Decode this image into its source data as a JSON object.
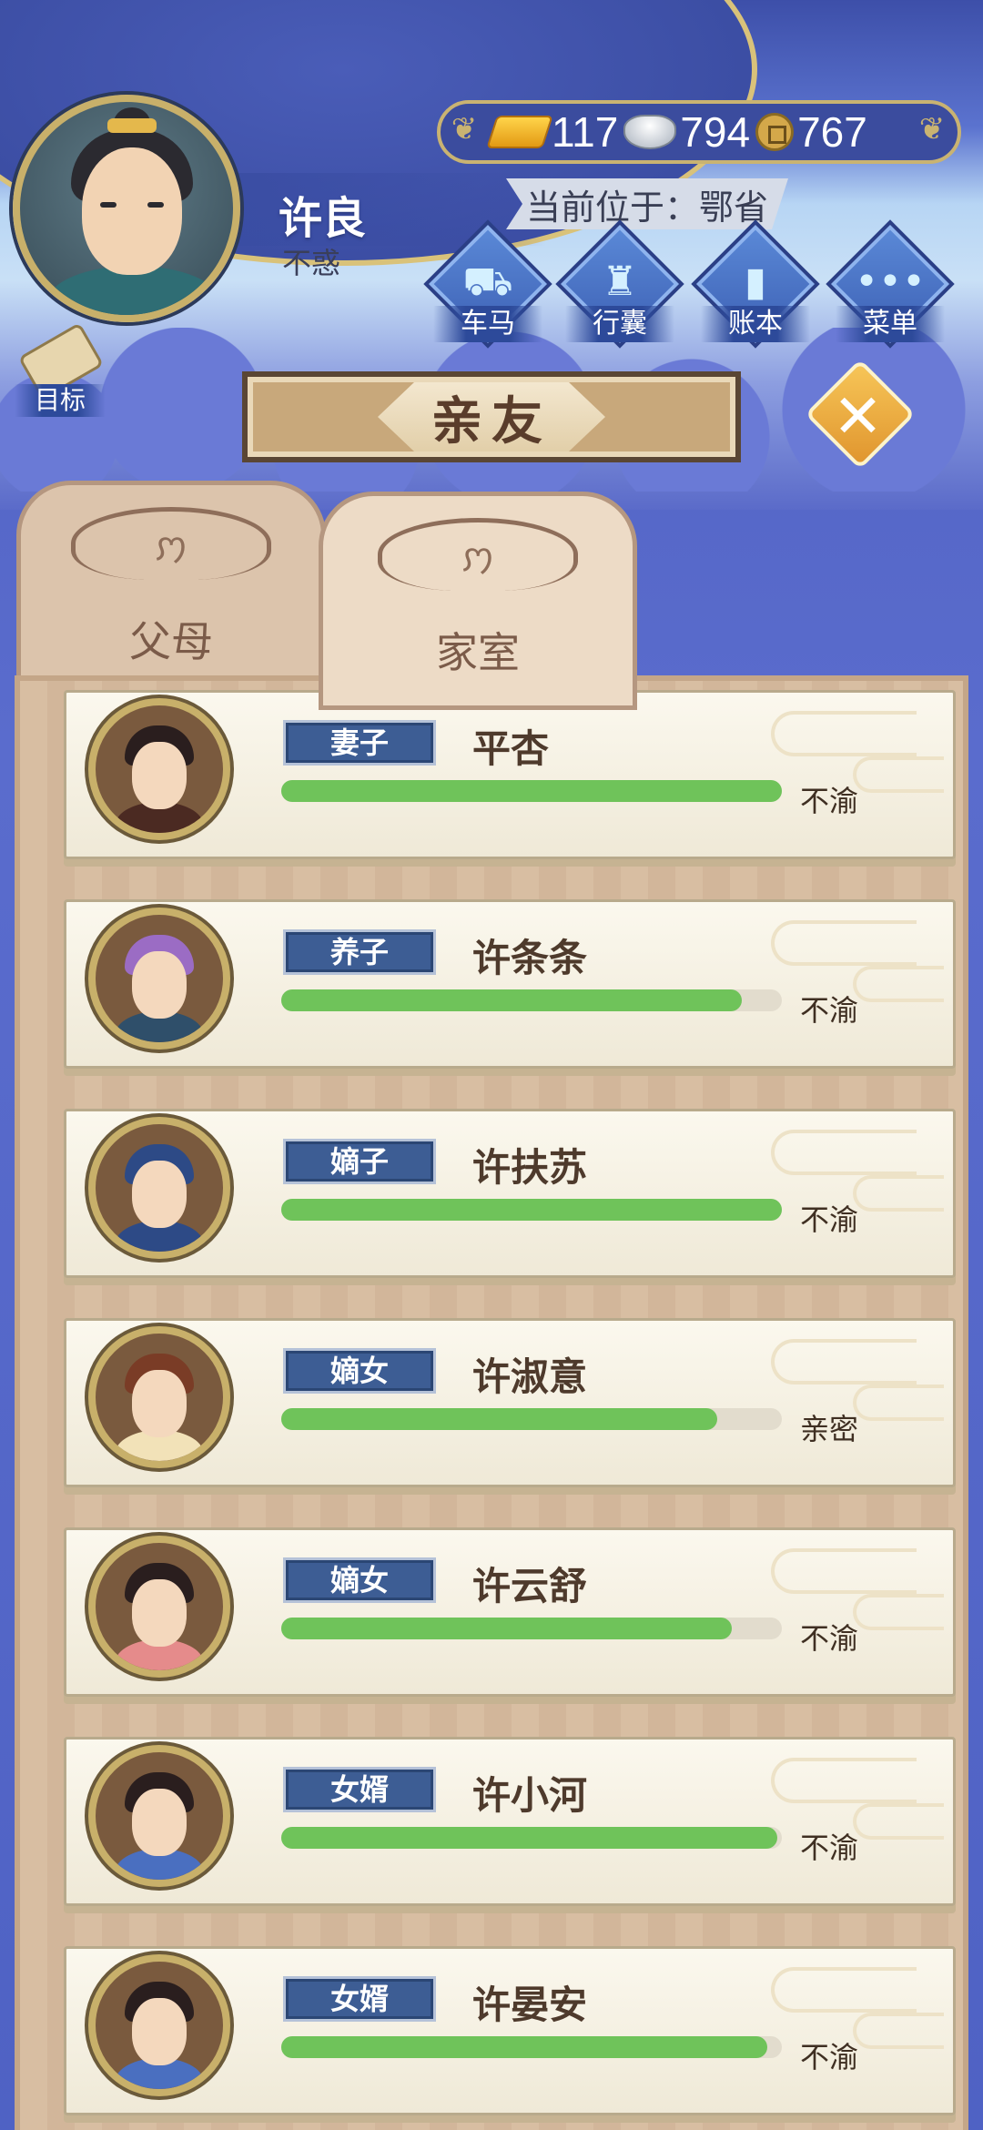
{
  "player": {
    "name": "许良",
    "title": "不惑"
  },
  "currency": {
    "gold": "117",
    "silver": "794",
    "coin": "767"
  },
  "location": "当前位于：鄂省",
  "menu": [
    {
      "label": "车马",
      "icon": "carriage-icon"
    },
    {
      "label": "行囊",
      "icon": "bag-icon"
    },
    {
      "label": "账本",
      "icon": "ledger-icon"
    },
    {
      "label": "菜单",
      "icon": "more-icon"
    }
  ],
  "goal_label": "目标",
  "banner_title": "亲友",
  "tabs": {
    "parents": "父母",
    "family": "家室"
  },
  "family": [
    {
      "relation": "妻子",
      "name": "平杏",
      "mood": "不渝",
      "affinity": 1.0,
      "robe": "#4b2a22",
      "hair": "#2a1e1e"
    },
    {
      "relation": "养子",
      "name": "许条条",
      "mood": "不渝",
      "affinity": 0.92,
      "robe": "#2f4f6a",
      "hair": "#9b6cc4"
    },
    {
      "relation": "嫡子",
      "name": "许扶苏",
      "mood": "不渝",
      "affinity": 1.0,
      "robe": "#2d4a86",
      "hair": "#2d4a86"
    },
    {
      "relation": "嫡女",
      "name": "许淑意",
      "mood": "亲密",
      "affinity": 0.87,
      "robe": "#f2e2b8",
      "hair": "#7a3c26"
    },
    {
      "relation": "嫡女",
      "name": "许云舒",
      "mood": "不渝",
      "affinity": 0.9,
      "robe": "#e58b8b",
      "hair": "#2a1e1e"
    },
    {
      "relation": "女婿",
      "name": "许小河",
      "mood": "不渝",
      "affinity": 0.99,
      "robe": "#4a6fc0",
      "hair": "#2a1e1e"
    },
    {
      "relation": "女婿",
      "name": "许晏安",
      "mood": "不渝",
      "affinity": 0.97,
      "robe": "#4a6fc0",
      "hair": "#2a1e1e"
    }
  ]
}
